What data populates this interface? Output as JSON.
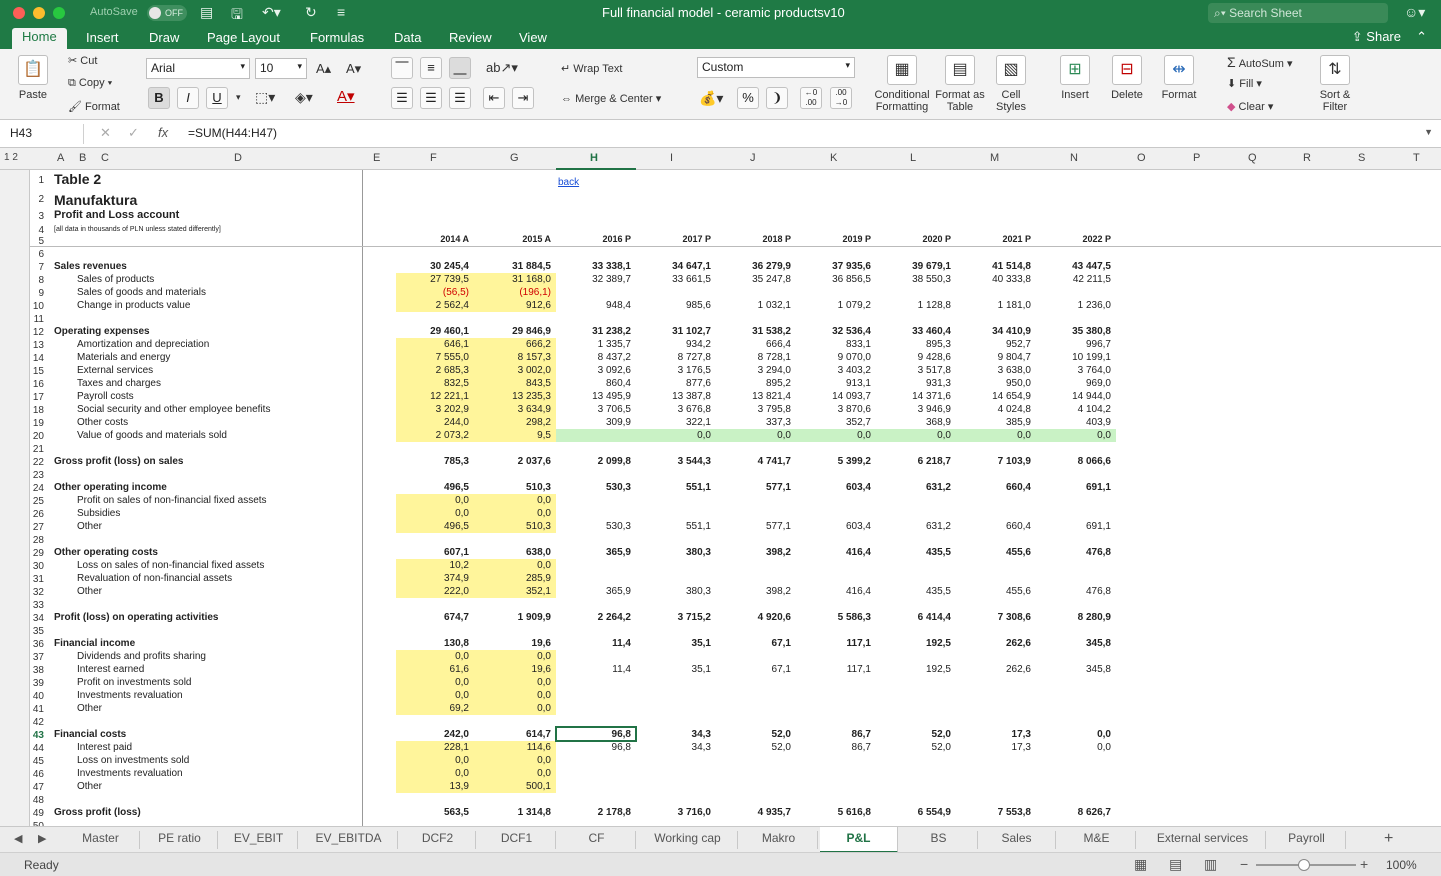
{
  "window": {
    "title": "Full financial model - ceramic productsv10",
    "autosave": "AutoSave",
    "autosave_state": "OFF",
    "search_placeholder": "Search Sheet"
  },
  "ribbon_tabs": [
    "Home",
    "Insert",
    "Draw",
    "Page Layout",
    "Formulas",
    "Data",
    "Review",
    "View"
  ],
  "share": "Share",
  "ribbon": {
    "paste": "Paste",
    "cut": "Cut",
    "copy": "Copy",
    "format_painter": "Format",
    "font": "Arial",
    "size": "10",
    "bold": "B",
    "italic": "I",
    "underline": "U",
    "wrap": "Wrap Text",
    "merge": "Merge & Center",
    "number_format": "Custom",
    "percent": "%",
    "cond": "Conditional Formatting",
    "table": "Format as Table",
    "styles": "Cell Styles",
    "insert": "Insert",
    "delete": "Delete",
    "format": "Format",
    "autosum": "AutoSum",
    "fill": "Fill",
    "clear": "Clear",
    "sort": "Sort & Filter"
  },
  "formula_bar": {
    "name": "H43",
    "fx": "fx",
    "formula": "=SUM(H44:H47)"
  },
  "columns": [
    "A",
    "B",
    "C",
    "D",
    "E",
    "F",
    "G",
    "H",
    "I",
    "J",
    "K",
    "L",
    "M",
    "N",
    "O",
    "P",
    "Q",
    "R",
    "S",
    "T"
  ],
  "outline": {
    "levels": "1 2"
  },
  "header": {
    "t1": "Table 2",
    "t2": "Manufaktura",
    "t3": "Profit and Loss account",
    "t4": "[all data in thousands of PLN unless stated differently]",
    "back": "back"
  },
  "years": [
    "2014 A",
    "2015 A",
    "2016 P",
    "2017 P",
    "2018 P",
    "2019 P",
    "2020 P",
    "2021 P",
    "2022 P"
  ],
  "rows": [
    {
      "n": 7,
      "label": "Sales revenues",
      "bold": true,
      "indent": false,
      "v": [
        "30 245,4",
        "31 884,5",
        "33 338,1",
        "34 647,1",
        "36 279,9",
        "37 935,6",
        "39 679,1",
        "41 514,8",
        "43 447,5"
      ]
    },
    {
      "n": 8,
      "label": "Sales of products",
      "indent": true,
      "y": 2,
      "v": [
        "27 739,5",
        "31 168,0",
        "32 389,7",
        "33 661,5",
        "35 247,8",
        "36 856,5",
        "38 550,3",
        "40 333,8",
        "42 211,5"
      ]
    },
    {
      "n": 9,
      "label": "Sales of goods and materials",
      "indent": true,
      "y": 2,
      "red": true,
      "v": [
        "(56,5)",
        "(196,1)",
        "",
        "",
        "",
        "",
        "",
        "",
        ""
      ]
    },
    {
      "n": 10,
      "label": "Change in products value",
      "indent": true,
      "y": 2,
      "v": [
        "2 562,4",
        "912,6",
        "948,4",
        "985,6",
        "1 032,1",
        "1 079,2",
        "1 128,8",
        "1 181,0",
        "1 236,0"
      ]
    },
    {
      "n": 11,
      "label": "",
      "v": []
    },
    {
      "n": 12,
      "label": "Operating expenses",
      "bold": true,
      "v": [
        "29 460,1",
        "29 846,9",
        "31 238,2",
        "31 102,7",
        "31 538,2",
        "32 536,4",
        "33 460,4",
        "34 410,9",
        "35 380,8"
      ]
    },
    {
      "n": 13,
      "label": "Amortization and depreciation",
      "indent": true,
      "y": 2,
      "v": [
        "646,1",
        "666,2",
        "1 335,7",
        "934,2",
        "666,4",
        "833,1",
        "895,3",
        "952,7",
        "996,7"
      ]
    },
    {
      "n": 14,
      "label": "Materials and energy",
      "indent": true,
      "y": 2,
      "v": [
        "7 555,0",
        "8 157,3",
        "8 437,2",
        "8 727,8",
        "8 728,1",
        "9 070,0",
        "9 428,6",
        "9 804,7",
        "10 199,1"
      ]
    },
    {
      "n": 15,
      "label": "External services",
      "indent": true,
      "y": 2,
      "v": [
        "2 685,3",
        "3 002,0",
        "3 092,6",
        "3 176,5",
        "3 294,0",
        "3 403,2",
        "3 517,8",
        "3 638,0",
        "3 764,0"
      ]
    },
    {
      "n": 16,
      "label": "Taxes and charges",
      "indent": true,
      "y": 2,
      "v": [
        "832,5",
        "843,5",
        "860,4",
        "877,6",
        "895,2",
        "913,1",
        "931,3",
        "950,0",
        "969,0"
      ]
    },
    {
      "n": 17,
      "label": "Payroll costs",
      "indent": true,
      "y": 2,
      "v": [
        "12 221,1",
        "13 235,3",
        "13 495,9",
        "13 387,8",
        "13 821,4",
        "14 093,7",
        "14 371,6",
        "14 654,9",
        "14 944,0"
      ]
    },
    {
      "n": 18,
      "label": "Social security and other employee benefits",
      "indent": true,
      "y": 2,
      "v": [
        "3 202,9",
        "3 634,9",
        "3 706,5",
        "3 676,8",
        "3 795,8",
        "3 870,6",
        "3 946,9",
        "4 024,8",
        "4 104,2"
      ]
    },
    {
      "n": 19,
      "label": "Other costs",
      "indent": true,
      "y": 2,
      "v": [
        "244,0",
        "298,2",
        "309,9",
        "322,1",
        "337,3",
        "352,7",
        "368,9",
        "385,9",
        "403,9"
      ]
    },
    {
      "n": 20,
      "label": "Value of goods and materials sold",
      "indent": true,
      "y": 2,
      "g": true,
      "v": [
        "2 073,2",
        "9,5",
        "",
        "0,0",
        "0,0",
        "0,0",
        "0,0",
        "0,0",
        "0,0"
      ]
    },
    {
      "n": 21,
      "label": "",
      "v": []
    },
    {
      "n": 22,
      "label": "Gross profit (loss) on sales",
      "bold": true,
      "v": [
        "785,3",
        "2 037,6",
        "2 099,8",
        "3 544,3",
        "4 741,7",
        "5 399,2",
        "6 218,7",
        "7 103,9",
        "8 066,6"
      ]
    },
    {
      "n": 23,
      "label": "",
      "v": []
    },
    {
      "n": 24,
      "label": "Other operating income",
      "bold": true,
      "v": [
        "496,5",
        "510,3",
        "530,3",
        "551,1",
        "577,1",
        "603,4",
        "631,2",
        "660,4",
        "691,1"
      ]
    },
    {
      "n": 25,
      "label": "Profit on sales of non-financial fixed assets",
      "indent": true,
      "y": 2,
      "v": [
        "0,0",
        "0,0",
        "",
        "",
        "",
        "",
        "",
        "",
        ""
      ]
    },
    {
      "n": 26,
      "label": "Subsidies",
      "indent": true,
      "y": 2,
      "v": [
        "0,0",
        "0,0",
        "",
        "",
        "",
        "",
        "",
        "",
        ""
      ]
    },
    {
      "n": 27,
      "label": "Other",
      "indent": true,
      "y": 2,
      "v": [
        "496,5",
        "510,3",
        "530,3",
        "551,1",
        "577,1",
        "603,4",
        "631,2",
        "660,4",
        "691,1"
      ]
    },
    {
      "n": 28,
      "label": "",
      "v": []
    },
    {
      "n": 29,
      "label": "Other operating costs",
      "bold": true,
      "v": [
        "607,1",
        "638,0",
        "365,9",
        "380,3",
        "398,2",
        "416,4",
        "435,5",
        "455,6",
        "476,8"
      ]
    },
    {
      "n": 30,
      "label": "Loss on sales of non-financial fixed assets",
      "indent": true,
      "y": 2,
      "v": [
        "10,2",
        "0,0",
        "",
        "",
        "",
        "",
        "",
        "",
        ""
      ]
    },
    {
      "n": 31,
      "label": "Revaluation of non-financial assets",
      "indent": true,
      "y": 2,
      "v": [
        "374,9",
        "285,9",
        "",
        "",
        "",
        "",
        "",
        "",
        ""
      ]
    },
    {
      "n": 32,
      "label": "Other",
      "indent": true,
      "y": 2,
      "v": [
        "222,0",
        "352,1",
        "365,9",
        "380,3",
        "398,2",
        "416,4",
        "435,5",
        "455,6",
        "476,8"
      ]
    },
    {
      "n": 33,
      "label": "",
      "v": []
    },
    {
      "n": 34,
      "label": "Profit (loss) on operating activities",
      "bold": true,
      "v": [
        "674,7",
        "1 909,9",
        "2 264,2",
        "3 715,2",
        "4 920,6",
        "5 586,3",
        "6 414,4",
        "7 308,6",
        "8 280,9"
      ]
    },
    {
      "n": 35,
      "label": "",
      "v": []
    },
    {
      "n": 36,
      "label": "Financial income",
      "bold": true,
      "v": [
        "130,8",
        "19,6",
        "11,4",
        "35,1",
        "67,1",
        "117,1",
        "192,5",
        "262,6",
        "345,8"
      ]
    },
    {
      "n": 37,
      "label": "Dividends and profits sharing",
      "indent": true,
      "y": 2,
      "v": [
        "0,0",
        "0,0",
        "",
        "",
        "",
        "",
        "",
        "",
        ""
      ]
    },
    {
      "n": 38,
      "label": "Interest earned",
      "indent": true,
      "y": 2,
      "v": [
        "61,6",
        "19,6",
        "11,4",
        "35,1",
        "67,1",
        "117,1",
        "192,5",
        "262,6",
        "345,8"
      ]
    },
    {
      "n": 39,
      "label": "Profit on investments sold",
      "indent": true,
      "y": 2,
      "v": [
        "0,0",
        "0,0",
        "",
        "",
        "",
        "",
        "",
        "",
        ""
      ]
    },
    {
      "n": 40,
      "label": "Investments revaluation",
      "indent": true,
      "y": 2,
      "v": [
        "0,0",
        "0,0",
        "",
        "",
        "",
        "",
        "",
        "",
        ""
      ]
    },
    {
      "n": 41,
      "label": "Other",
      "indent": true,
      "y": 2,
      "v": [
        "69,2",
        "0,0",
        "",
        "",
        "",
        "",
        "",
        "",
        ""
      ]
    },
    {
      "n": 42,
      "label": "",
      "v": []
    },
    {
      "n": 43,
      "label": "Financial costs",
      "bold": true,
      "v": [
        "242,0",
        "614,7",
        "96,8",
        "34,3",
        "52,0",
        "86,7",
        "52,0",
        "17,3",
        "0,0"
      ]
    },
    {
      "n": 44,
      "label": "Interest paid",
      "indent": true,
      "y": 2,
      "v": [
        "228,1",
        "114,6",
        "96,8",
        "34,3",
        "52,0",
        "86,7",
        "52,0",
        "17,3",
        "0,0"
      ]
    },
    {
      "n": 45,
      "label": "Loss on investments sold",
      "indent": true,
      "y": 2,
      "v": [
        "0,0",
        "0,0",
        "",
        "",
        "",
        "",
        "",
        "",
        ""
      ]
    },
    {
      "n": 46,
      "label": "Investments revaluation",
      "indent": true,
      "y": 2,
      "v": [
        "0,0",
        "0,0",
        "",
        "",
        "",
        "",
        "",
        "",
        ""
      ]
    },
    {
      "n": 47,
      "label": "Other",
      "indent": true,
      "y": 2,
      "v": [
        "13,9",
        "500,1",
        "",
        "",
        "",
        "",
        "",
        "",
        ""
      ]
    },
    {
      "n": 48,
      "label": "",
      "v": []
    },
    {
      "n": 49,
      "label": "Gross profit (loss)",
      "bold": true,
      "v": [
        "563,5",
        "1 314,8",
        "2 178,8",
        "3 716,0",
        "4 935,7",
        "5 616,8",
        "6 554,9",
        "7 553,8",
        "8 626,7"
      ]
    },
    {
      "n": 50,
      "label": "",
      "v": []
    }
  ],
  "sheet_tabs": [
    "Master",
    "PE ratio",
    "EV_EBIT",
    "EV_EBITDA",
    "DCF2",
    "DCF1",
    "CF",
    "Working cap",
    "Makro",
    "P&L",
    "BS",
    "Sales",
    "M&E",
    "External services",
    "Payroll"
  ],
  "active_sheet": "P&L",
  "status": {
    "text": "Ready",
    "zoom": "100%"
  }
}
